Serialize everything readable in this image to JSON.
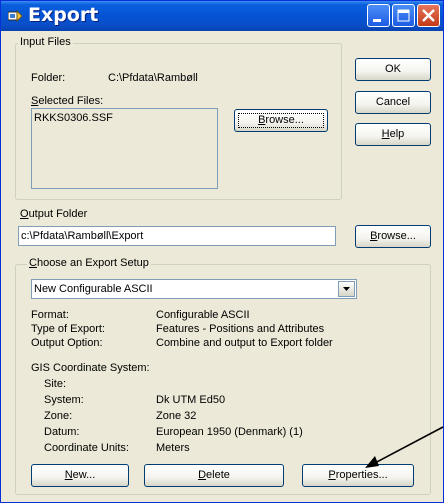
{
  "window": {
    "title": "Export",
    "accent": "#0553d4",
    "face": "#ece9d8"
  },
  "titlebar_buttons": [
    "minimize-icon",
    "maximize-icon",
    "close-icon"
  ],
  "buttons": {
    "ok": "OK",
    "cancel": "Cancel",
    "help": "Help"
  },
  "input_files": {
    "legend": "Input Files",
    "folder_label": "Folder:",
    "folder_value": "C:\\Pfdata\\Rambøll",
    "selected_label": "Selected Files:",
    "files": [
      "RKKS0306.SSF"
    ],
    "browse": "Browse..."
  },
  "output_folder": {
    "label": "Output Folder",
    "value": "c:\\Pfdata\\Rambøll\\Export",
    "browse": "Browse..."
  },
  "export_setup": {
    "legend": "Choose an Export Setup",
    "selected": "New Configurable ASCII",
    "details": [
      {
        "label": "Format:",
        "value": "Configurable ASCII"
      },
      {
        "label": "Type of Export:",
        "value": "Features - Positions and Attributes"
      },
      {
        "label": "Output Option:",
        "value": "Combine and output to Export folder"
      }
    ],
    "gis_heading": "GIS Coordinate System:",
    "gis": [
      {
        "label": "Site:",
        "value": ""
      },
      {
        "label": "System:",
        "value": "Dk UTM Ed50"
      },
      {
        "label": "Zone:",
        "value": "Zone 32"
      },
      {
        "label": "Datum:",
        "value": "European 1950 (Denmark) (1)"
      },
      {
        "label": "Coordinate Units:",
        "value": "Meters"
      }
    ],
    "new": "New...",
    "delete": "Delete",
    "properties": "Properties..."
  }
}
